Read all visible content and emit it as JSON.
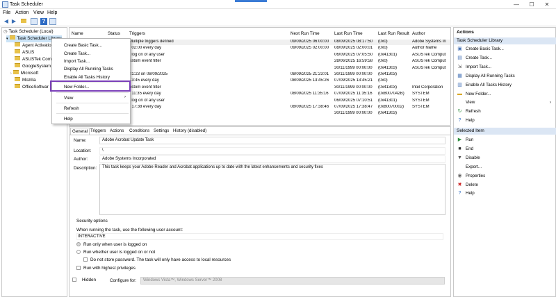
{
  "window": {
    "title": "Task Scheduler",
    "controls": [
      "—",
      "☐",
      "✕"
    ]
  },
  "menu": [
    "File",
    "Action",
    "View",
    "Help"
  ],
  "tree": {
    "root": "Task Scheduler (Local)",
    "library": "Task Scheduler Library",
    "folders": [
      "Agent Activatio",
      "ASUS",
      "ASUSTek Comp",
      "GoogleSystem",
      "Microsoft",
      "Mozilla",
      "OfficeSoftwar"
    ]
  },
  "task_table": {
    "columns": [
      "Name",
      "Status",
      "Triggers",
      "Next Run Time",
      "Last Run Time",
      "Last Run Result",
      "Author"
    ],
    "rows": [
      {
        "trigger": "Multiple triggers defined",
        "next": "09/09/2025 06:00:00",
        "last": "08/09/2025 08:17:50",
        "result": "(0x0)",
        "author": "Adobe Systems In"
      },
      {
        "trigger": "t 02:00 every day",
        "next": "09/09/2025 02:00:00",
        "last": "08/09/2025 02:00:01",
        "result": "(0x0)",
        "author": "Author Name"
      },
      {
        "trigger": "t log on of any user",
        "next": "",
        "last": "06/09/2025 07:05:50",
        "result": "(0x41301)",
        "author": "ASUSTek Comput"
      },
      {
        "trigger": "ustom event filter",
        "next": "",
        "last": "28/06/2025 16:59:58",
        "result": "(0x0)",
        "author": "ASUSTek Comput"
      },
      {
        "trigger": "",
        "next": "",
        "last": "30/11/1999 00:00:00",
        "result": "(0x41303)",
        "author": "ASUSTek Comput"
      },
      {
        "trigger": "21:23 on 08/09/2025",
        "next": "08/09/2025 21:23:01",
        "last": "30/11/1999 00:00:00",
        "result": "(0x41303)",
        "author": ""
      },
      {
        "trigger": "13:45 every day",
        "next": "08/09/2025 13:45:26",
        "last": "07/09/2025 13:45:21",
        "result": "(0x0)",
        "author": ""
      },
      {
        "trigger": "ustom event filter",
        "next": "",
        "last": "30/11/1999 00:00:00",
        "result": "(0x41303)",
        "author": "Intel Corporation"
      },
      {
        "trigger": "t 11:35 every day",
        "next": "08/09/2025 11:35:16",
        "last": "07/09/2025 11:35:16",
        "result": "(0x8007042B)",
        "author": "SYSTEM"
      },
      {
        "trigger": "t log on of any user",
        "next": "",
        "last": "06/09/2025 07:10:51",
        "result": "(0x41301)",
        "author": "SYSTEM"
      },
      {
        "trigger": "t 17:38 every day",
        "next": "08/09/2025 17:38:46",
        "last": "07/09/2025 17:38:47",
        "result": "(0x80070002)",
        "author": "SYSTEM"
      },
      {
        "trigger": "",
        "next": "",
        "last": "30/11/1999 00:00:00",
        "result": "(0x41303)",
        "author": ""
      }
    ]
  },
  "context_menu": {
    "items": [
      "Create Basic Task...",
      "Create Task...",
      "Import Task...",
      "Display All Running Tasks",
      "Enable All Tasks History",
      "New Folder...",
      "View",
      "Refresh",
      "Help"
    ],
    "highlight_color": "#7a3fb8"
  },
  "detail": {
    "tabs": [
      "General",
      "Triggers",
      "Actions",
      "Conditions",
      "Settings",
      "History (disabled)"
    ],
    "name_label": "Name:",
    "name_value": "Adobe Acrobat Update Task",
    "location_label": "Location:",
    "location_value": "\\",
    "author_label": "Author:",
    "author_value": "Adobe Systems Incorporated",
    "description_label": "Description:",
    "description_value": "This task keeps your Adobe Reader and Acrobat applications up to date with the latest enhancements and security fixes",
    "security_title": "Security options",
    "security_prompt": "When running the task, use the following user account:",
    "security_account": "INTERACTIVE",
    "opt_logged_on": "Run only when user is logged on",
    "opt_whether": "Run whether user is logged on or not",
    "opt_no_store": "Do not store password.  The task will only have access to local resources",
    "opt_highest": "Run with highest privileges",
    "hidden_label": "Hidden",
    "configure_label": "Configure for:",
    "configure_value": "Windows Vista™, Windows Server™ 2008"
  },
  "actions": {
    "title": "Actions",
    "section1": "Task Scheduler Library",
    "section1_items": [
      {
        "label": "Create Basic Task...",
        "icon": "basic-task-icon"
      },
      {
        "label": "Create Task...",
        "icon": "create-task-icon"
      },
      {
        "label": "Import Task...",
        "icon": "import-icon"
      },
      {
        "label": "Display All Running Tasks",
        "icon": "running-tasks-icon"
      },
      {
        "label": "Enable All Tasks History",
        "icon": "history-icon"
      },
      {
        "label": "New Folder...",
        "icon": "folder-icon"
      },
      {
        "label": "View",
        "icon": "view-icon"
      },
      {
        "label": "Refresh",
        "icon": "refresh-icon"
      },
      {
        "label": "Help",
        "icon": "help-icon"
      }
    ],
    "section2": "Selected Item",
    "section2_items": [
      {
        "label": "Run",
        "icon": "run-icon"
      },
      {
        "label": "End",
        "icon": "end-icon"
      },
      {
        "label": "Disable",
        "icon": "disable-icon"
      },
      {
        "label": "Export...",
        "icon": "export-icon"
      },
      {
        "label": "Properties",
        "icon": "properties-icon"
      },
      {
        "label": "Delete",
        "icon": "delete-icon"
      },
      {
        "label": "Help",
        "icon": "help-icon"
      }
    ]
  }
}
